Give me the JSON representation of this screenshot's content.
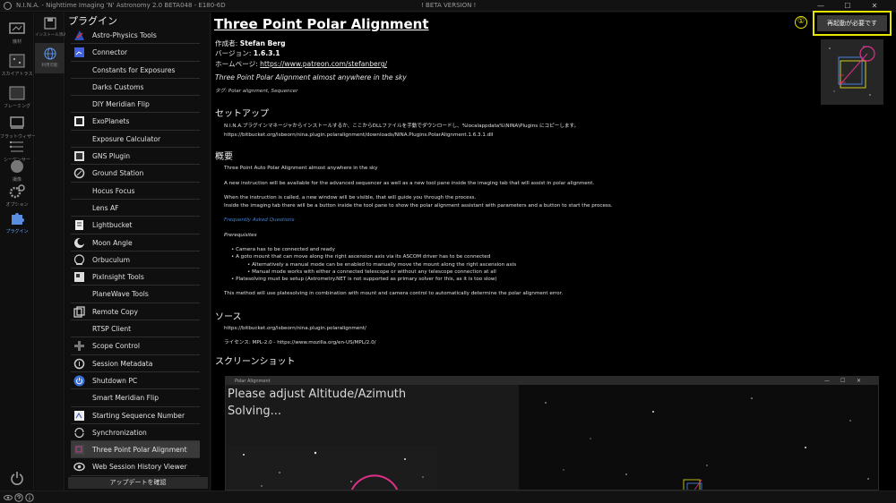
{
  "window": {
    "title": "N.I.N.A. - Nighttime Imaging 'N' Astronomy 2.0 BETA048  -  E180-6D",
    "beta_label": "! BETA VERSION !",
    "minimize": "—",
    "maximize": "☐",
    "close": "✕"
  },
  "leftnav": [
    {
      "label": "機材"
    },
    {
      "label": "スカイアトラス"
    },
    {
      "label": "フレーミング"
    },
    {
      "label": "フラットウィザード"
    },
    {
      "label": "シーケンサー"
    },
    {
      "label": "撮像"
    },
    {
      "label": "オプション"
    },
    {
      "label": "プラグイン"
    }
  ],
  "subnav": [
    {
      "label": "インストール済み"
    },
    {
      "label": "利用可能"
    }
  ],
  "plugins": {
    "header": "プラグイン",
    "items": [
      "Astro-Physics Tools",
      "Connector",
      "Constants for Exposures",
      "Darks Customs",
      "DIY Meridian Flip",
      "ExoPlanets",
      "Exposure Calculator",
      "GNS Plugin",
      "Ground Station",
      "Hocus Focus",
      "Lens AF",
      "Lightbucket",
      "Moon Angle",
      "Orbuculum",
      "PixInsight Tools",
      "PlaneWave Tools",
      "Remote Copy",
      "RTSP Client",
      "Scope Control",
      "Session Metadata",
      "Shutdown PC",
      "Smart Meridian Flip",
      "Starting Sequence Number",
      "Synchronization",
      "Three Point Polar Alignment",
      "Web Session History Viewer"
    ],
    "selected": "Three Point Polar Alignment",
    "update_button": "アップデートを確認"
  },
  "detail": {
    "title": "Three Point Polar Alignment",
    "author_label": "作成者:",
    "author": "Stefan Berg",
    "version_label": "バージョン:",
    "version": "1.6.3.1",
    "homepage_label": "ホームページ:",
    "homepage": "https://www.patreon.com/stefanberg/",
    "short_desc": "Three Point Polar Alignment almost anywhere in the sky",
    "tags_label": "タグ:",
    "tags": "Polar alignment, Sequencer",
    "restart_number": "①",
    "restart_button": "再起動が必要です",
    "setup": {
      "heading": "セットアップ",
      "text": "N.I.N.A.プラグインマネージャからインストールするか、ここからDLLファイルを手動でダウンロードし、%localappdata%\\NINA\\Plugins にコピーします。",
      "url": "https://bitbucket.org/isbeorn/nina.plugin.polaralignment/downloads/NINA.Plugins.PolarAlignment.1.6.3.1.dll"
    },
    "overview": {
      "heading": "概要",
      "p1": "Three Point Auto Polar Alignment almost anywhere in the sky",
      "p2": "A new instruction will be available for the advanced sequencer as well as a new tool pane inside the imaging tab that will assist in polar alignment.",
      "p3": "When the instruction is called, a new window will be visible, that will guide you through the process.",
      "p4": "Inside the imaging tab there will be a button inside the tool pane to show the polar alignment assistant with parameters and a button to start the process.",
      "faq": "Frequently Asked Questions",
      "prereq": "Prerequisites",
      "b1": "Camera has to be connected and ready",
      "b2": "A goto mount that can move along the right ascension axis via its ASCOM driver has to be connected",
      "b2a": "Alternatively a manual mode can be enabled to manually move the mount along the right ascension axis",
      "b2b": "Manual mode works with either a connected telescope or without any telescope connection at all",
      "b3": "Platesolving must be setup (Astrometry.NET is not supported as primary solver for this, as it is too slow)",
      "p5": "This method will use platesolving in combination with mount and camera control to automatically determine the polar alignment error."
    },
    "source": {
      "heading": "ソース",
      "url": "https://bitbucket.org/isbeorn/nina.plugin.polaralignment/",
      "license": "ライセンス: MPL-2.0  -  https://www.mozilla.org/en-US/MPL/2.0/"
    },
    "screenshot": {
      "heading": "スクリーンショット",
      "window_title": "Polar Alignment",
      "line1": "Please adjust Altitude/Azimuth",
      "line2": "Solving..."
    }
  }
}
